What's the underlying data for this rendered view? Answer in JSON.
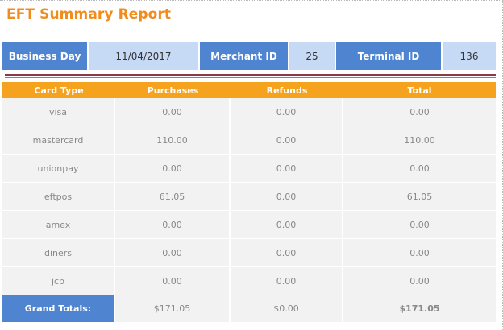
{
  "title": "EFT Summary Report",
  "info": {
    "business_day_label": "Business Day",
    "business_day": "11/04/2017",
    "merchant_label": "Merchant ID",
    "merchant_id": "25",
    "terminal_label": "Terminal ID",
    "terminal_id": "136"
  },
  "table": {
    "headers": [
      "Card Type",
      "Purchases",
      "Refunds",
      "Total"
    ],
    "rows": [
      [
        "visa",
        "0.00",
        "0.00",
        "0.00"
      ],
      [
        "mastercard",
        "110.00",
        "0.00",
        "110.00"
      ],
      [
        "unionpay",
        "0.00",
        "0.00",
        "0.00"
      ],
      [
        "eftpos",
        "61.05",
        "0.00",
        "61.05"
      ],
      [
        "amex",
        "0.00",
        "0.00",
        "0.00"
      ],
      [
        "diners",
        "0.00",
        "0.00",
        "0.00"
      ],
      [
        "jcb",
        "0.00",
        "0.00",
        "0.00"
      ]
    ],
    "totals": {
      "label": "Grand Totals:",
      "purchases": "$171.05",
      "refunds": "$0.00",
      "total": "$171.05"
    }
  },
  "colors": {
    "title": "#f08c1c",
    "label_blue": "#4f84d1",
    "value_blue": "#c6daf6",
    "header_orange": "#f5a31e"
  }
}
